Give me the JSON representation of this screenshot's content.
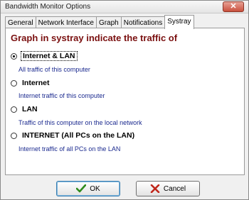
{
  "window": {
    "title": "Bandwidth Monitor Options",
    "close_glyph": "✕"
  },
  "tabs": [
    {
      "label": "General",
      "active": false
    },
    {
      "label": "Network Interface",
      "active": false
    },
    {
      "label": "Graph",
      "active": false
    },
    {
      "label": "Notifications",
      "active": false
    },
    {
      "label": "Systray",
      "active": true
    }
  ],
  "systray": {
    "heading": "Graph in systray indicate the traffic of",
    "options": [
      {
        "label": "Internet & LAN",
        "description": "All traffic of this computer",
        "selected": true
      },
      {
        "label": "Internet",
        "description": "Internet traffic of this computer",
        "selected": false
      },
      {
        "label": "LAN",
        "description": "Traffic of this computer on the local network",
        "selected": false
      },
      {
        "label": "INTERNET (All PCs on the LAN)",
        "description": "Internet traffic of all PCs on the LAN",
        "selected": false
      }
    ]
  },
  "buttons": {
    "ok_label": "OK",
    "cancel_label": "Cancel"
  },
  "colors": {
    "heading": "#7a1010",
    "description": "#1b2a8f",
    "ok_icon": "#2e8b1e",
    "cancel_icon": "#c0261a"
  },
  "icons": {
    "ok": "checkmark-icon",
    "cancel": "x-mark-icon",
    "close": "close-icon"
  }
}
